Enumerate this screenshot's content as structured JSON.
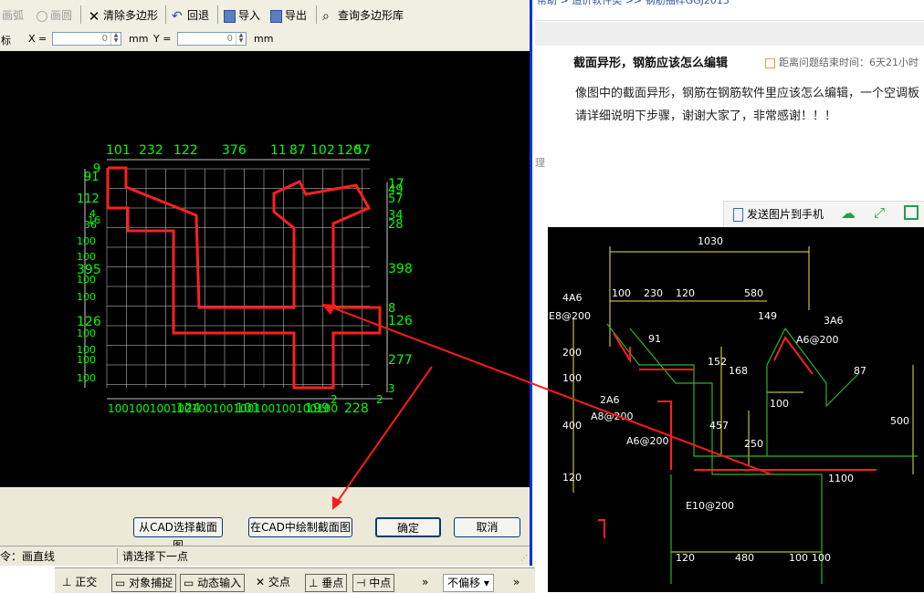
{
  "toolbar": {
    "arc": "画弧",
    "circle": "画圆",
    "clear": "清除多边形",
    "undo": "回退",
    "import": "导入",
    "export": "导出",
    "query": "查询多边形库"
  },
  "coords": {
    "label": "标",
    "x_label": "X =",
    "x_value": "0",
    "x_unit": "mm",
    "y_label": "Y =",
    "y_value": "0",
    "y_unit": "mm"
  },
  "dims": {
    "top": [
      "101",
      "232",
      "122",
      "376",
      "11",
      "87",
      "102",
      "120",
      "57"
    ],
    "left": [
      "9",
      "91",
      "112",
      "4",
      "16",
      "36",
      "100",
      "100",
      "395",
      "100",
      "100",
      "126",
      "100",
      "100",
      "100",
      "100"
    ],
    "right": [
      "17",
      "49",
      "57",
      "34",
      "28",
      "398",
      "8",
      "126",
      "277",
      "3"
    ],
    "bottom": [
      "100100100100100100100100100100100",
      "124",
      "101",
      "199",
      "228",
      "2",
      "2"
    ]
  },
  "buttons": {
    "from_cad": "从CAD选择截面图",
    "draw_cad": "在CAD中绘制截面图",
    "ok": "确定",
    "cancel": "取消"
  },
  "status": {
    "command": "令：画直线",
    "prompt": "请选择下一点"
  },
  "osbar": {
    "ortho": "正交",
    "osnap": "对象捕捉",
    "dyn": "动态输入",
    "intersect": "交点",
    "perp": "垂点",
    "mid": "中点",
    "more": "»",
    "offset": "不偏移",
    "more2": "»"
  },
  "web": {
    "breadcrumb": "帮助 > 造价软件类 >> 钢筋抽样GGJ2013",
    "side_char": "理",
    "question_title": "截面异形，钢筋应该怎么编辑",
    "time_label": "距离问题结束时间：",
    "time_value": "6天21小时",
    "body": "像图中的截面异形，钢筋在钢筋软件里应该怎么编辑，一个空调板请详细说明下步骤，谢谢大家了，非常感谢！！！",
    "send_to_phone": "发送图片到手机"
  },
  "cad": {
    "dims": [
      "1030",
      "100",
      "230",
      "120",
      "580",
      "149",
      "3A6",
      "A6@200",
      "4A6",
      "E8@200",
      "91",
      "152",
      "168",
      "200",
      "100",
      "2A6",
      "A8@200",
      "100",
      "457",
      "400",
      "A6@200",
      "250",
      "500",
      "120",
      "1100",
      "E10@200",
      "120",
      "480",
      "100",
      "100",
      "87"
    ]
  },
  "colors": {
    "polygon": "#ff2020",
    "dim_text": "#00ff00",
    "grid": "#ffffff",
    "arrow": "#ff1a1a",
    "dialog_border": "#0831d9"
  }
}
